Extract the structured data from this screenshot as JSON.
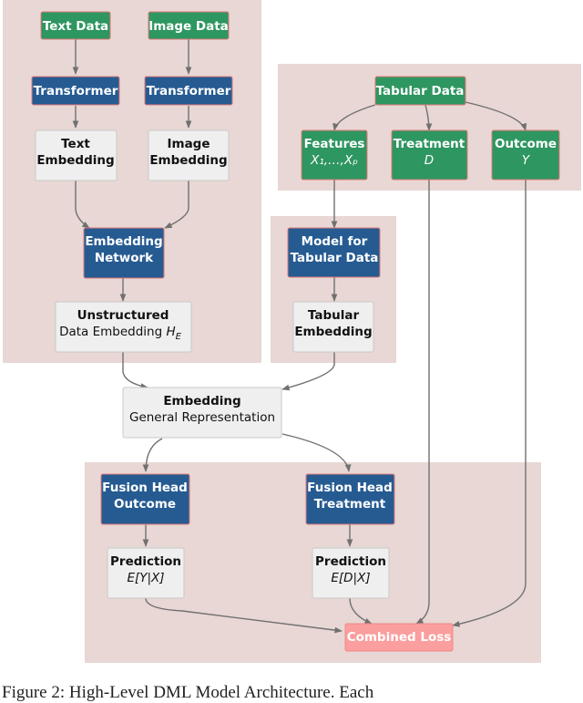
{
  "colors": {
    "cluster_bg": "#e8d7d4",
    "data_node": "#2e9660",
    "model_node": "#265b92",
    "embedding_node": "#efefef",
    "loss_node": "#fb9e9e",
    "edge": "#707070"
  },
  "nodes": {
    "text_data": {
      "label": "Text Data"
    },
    "image_data": {
      "label": "Image Data"
    },
    "text_transformer": {
      "label": "Transformer"
    },
    "image_transformer": {
      "label": "Transformer"
    },
    "text_embedding": {
      "line1": "Text",
      "line2": "Embedding"
    },
    "image_embedding": {
      "line1": "Image",
      "line2": "Embedding"
    },
    "embedding_network": {
      "line1": "Embedding",
      "line2": "Network"
    },
    "unstructured_embedding": {
      "line1": "Unstructured",
      "line2": "Data Embedding ",
      "symbol": "H",
      "subscript": "E"
    },
    "tabular_data": {
      "label": "Tabular Data"
    },
    "features": {
      "line1": "Features",
      "line2": "X₁,…,Xₚ"
    },
    "treatment": {
      "line1": "Treatment",
      "line2": "D"
    },
    "outcome": {
      "line1": "Outcome",
      "line2": "Y"
    },
    "tabular_model": {
      "line1": "Model for",
      "line2": "Tabular Data"
    },
    "tabular_embedding": {
      "line1": "Tabular",
      "line2": "Embedding"
    },
    "general_embedding": {
      "line1": "Embedding",
      "line2": "General Representation"
    },
    "fusion_outcome": {
      "line1": "Fusion Head",
      "line2": "Outcome"
    },
    "fusion_treatment": {
      "line1": "Fusion Head",
      "line2": "Treatment"
    },
    "prediction_outcome": {
      "line1": "Prediction",
      "line2": "E[Y|X]"
    },
    "prediction_treatment": {
      "line1": "Prediction",
      "line2": "E[D|X]"
    },
    "combined_loss": {
      "label": "Combined Loss"
    }
  },
  "caption": "Figure 2: High-Level DML Model Architecture. Each"
}
